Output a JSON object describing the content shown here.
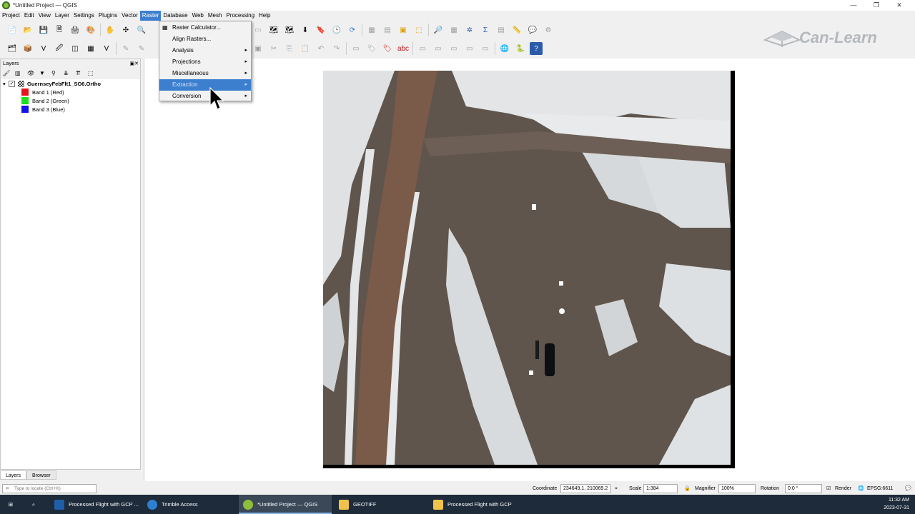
{
  "window": {
    "title": "*Untitled Project — QGIS",
    "controls": [
      "—",
      "❐",
      "✕"
    ]
  },
  "menubar": [
    "Project",
    "Edit",
    "View",
    "Layer",
    "Settings",
    "Plugins",
    "Vector",
    "Raster",
    "Database",
    "Web",
    "Mesh",
    "Processing",
    "Help"
  ],
  "active_menu": "Raster",
  "raster_menu": {
    "items": [
      {
        "label": "Raster Calculator...",
        "submenu": false
      },
      {
        "label": "Align Rasters...",
        "submenu": false
      },
      {
        "label": "Analysis",
        "submenu": true
      },
      {
        "label": "Projections",
        "submenu": true
      },
      {
        "label": "Miscellaneous",
        "submenu": true
      },
      {
        "label": "Extraction",
        "submenu": true
      },
      {
        "label": "Conversion",
        "submenu": true
      }
    ],
    "highlighted": "Extraction"
  },
  "logo": {
    "text": "Can-Learn"
  },
  "layers_panel": {
    "title": "Layers",
    "layer_name": "GuernseyFebFlt1_SO6.Ortho",
    "checked": true,
    "bands": [
      {
        "label": "Band 1 (Red)",
        "color": "#e8141b"
      },
      {
        "label": "Band 2 (Green)",
        "color": "#1ee01e"
      },
      {
        "label": "Band 3 (Blue)",
        "color": "#1414e6"
      }
    ],
    "tabs": [
      "Layers",
      "Browser"
    ]
  },
  "statusbar": {
    "locate_placeholder": "Type to locate (Ctrl+K)",
    "coordinate_label": "Coordinate",
    "coordinate_value": "234649.1, 210069.2",
    "scale_label": "Scale",
    "scale_value": "1:384",
    "magnifier_label": "Magnifier",
    "magnifier_value": "100%",
    "rotation_label": "Rotation",
    "rotation_value": "0.0 °",
    "render_label": "Render",
    "crs": "EPSG:6611"
  },
  "taskbar": {
    "items": [
      {
        "label": "Processed Flight with GCP ...",
        "color": "#1f5fa8"
      },
      {
        "label": "Trimble Access",
        "color": "#2e7fd0"
      },
      {
        "label": "*Untitled Project — QGIS",
        "color": "#8fbf3a"
      },
      {
        "label": "GEOTIFF",
        "color": "#f0c24a"
      },
      {
        "label": "Processed Flight with GCP",
        "color": "#f0c24a"
      }
    ],
    "time": "11:32 AM",
    "date": "2023-07-31"
  }
}
